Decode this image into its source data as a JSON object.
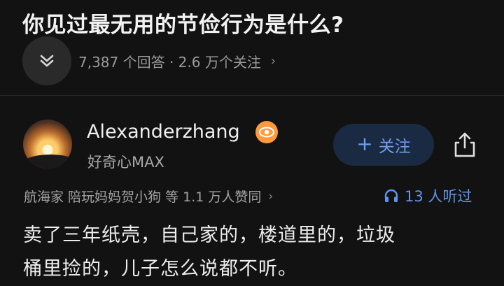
{
  "question": {
    "title": "你见过最无用的节俭行为是什么?",
    "meta": "7,387 个回答 · 2.6 万个关注",
    "meta_chevron": "›"
  },
  "answer": {
    "author_name": "Alexanderzhang",
    "author_sub": "好奇心MAX",
    "follow_plus": "+",
    "follow_label": "关注",
    "upvoters": "航海家  陪玩妈妈贺小狗  等 1.1 万人赞同",
    "upvoters_chevron": "›",
    "listen_label": "13 人听过",
    "body_line1": "卖了三年纸壳，自己家的，楼道里的，垃圾",
    "body_line2": "桶里捡的，儿子怎么说都不听。"
  },
  "icons": {
    "collapse": "chevron-double-down-icon",
    "badge": "eye-badge-icon",
    "share": "share-icon",
    "headphones": "headphones-icon"
  },
  "colors": {
    "background": "#121212",
    "accent_blue": "#5f95ee",
    "follow_bg": "#1b2a43",
    "badge_orange": "#ff9a3c"
  }
}
